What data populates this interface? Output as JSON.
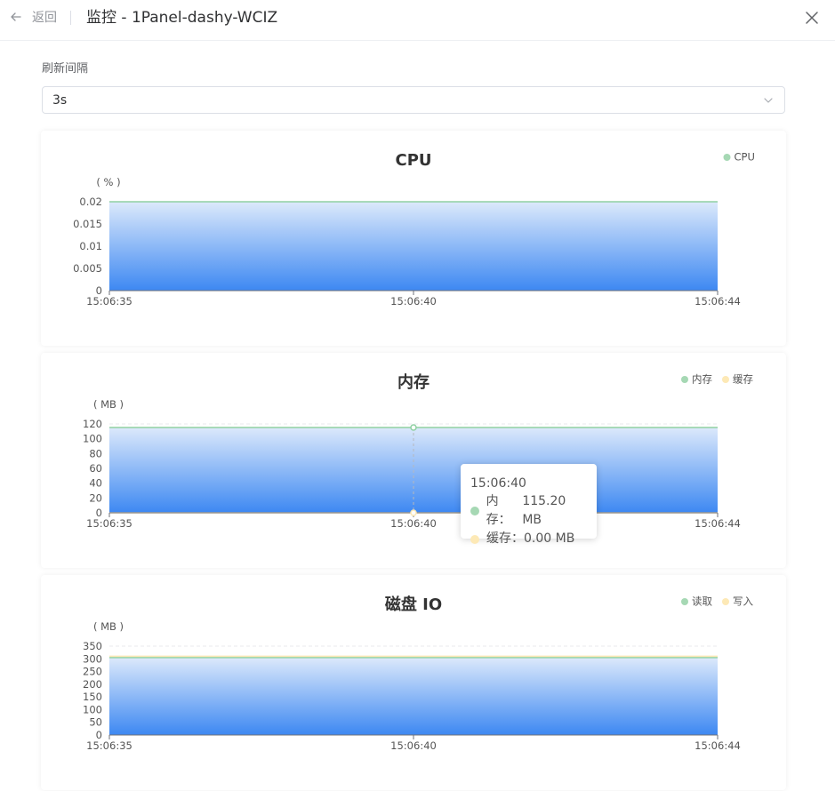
{
  "header": {
    "back_label": "返回",
    "title": "监控 - 1Panel-dashy-WCIZ"
  },
  "interval": {
    "label": "刷新间隔",
    "value": "3s"
  },
  "colors": {
    "area_top": "#dce9fb",
    "area_bottom": "#3d88f2",
    "green": "#a6d8b4",
    "yellow": "#fde9b6",
    "line_green": "#8fd0a2",
    "grid": "#e8eaed",
    "axis_text": "#555555",
    "title_text": "#333333"
  },
  "chart_data": [
    {
      "type": "area",
      "title": "CPU",
      "ylabel": "( % )",
      "ylim": [
        0,
        0.02
      ],
      "yticks": [
        "0",
        "0.005",
        "0.01",
        "0.015",
        "0.02"
      ],
      "x": [
        "15:06:35",
        "15:06:40",
        "15:06:44"
      ],
      "legend_position": "top-right",
      "series": [
        {
          "name": "CPU",
          "values": [
            0.02,
            0.02,
            0.02
          ],
          "color": "#a6d8b4",
          "fill": true
        }
      ]
    },
    {
      "type": "area",
      "title": "内存",
      "ylabel": "( MB )",
      "ylim": [
        0,
        120
      ],
      "yticks": [
        "0",
        "20",
        "40",
        "60",
        "80",
        "100",
        "120"
      ],
      "x": [
        "15:06:35",
        "15:06:40",
        "15:06:44"
      ],
      "legend_position": "top-right",
      "series": [
        {
          "name": "内存",
          "values": [
            115.2,
            115.2,
            115.2
          ],
          "color": "#a6d8b4",
          "fill": true
        },
        {
          "name": "缓存",
          "values": [
            0,
            0,
            0
          ],
          "color": "#fde9b6",
          "fill": false
        }
      ],
      "tooltip": {
        "time": "15:06:40",
        "rows": [
          {
            "label": "内存：",
            "value": "115.20 MB"
          },
          {
            "label": "缓存：",
            "value": "0.00 MB"
          }
        ]
      }
    },
    {
      "type": "area",
      "title": "磁盘 IO",
      "ylabel": "( MB )",
      "ylim": [
        0,
        350
      ],
      "yticks": [
        "0",
        "50",
        "100",
        "150",
        "200",
        "250",
        "300",
        "350"
      ],
      "x": [
        "15:06:35",
        "15:06:40",
        "15:06:44"
      ],
      "legend_position": "top-right",
      "series": [
        {
          "name": "读取",
          "values": [
            305,
            305,
            305
          ],
          "color": "#a6d8b4",
          "fill": true
        },
        {
          "name": "写入",
          "values": [
            310,
            310,
            310
          ],
          "color": "#fde9b6",
          "fill": false
        }
      ]
    }
  ]
}
